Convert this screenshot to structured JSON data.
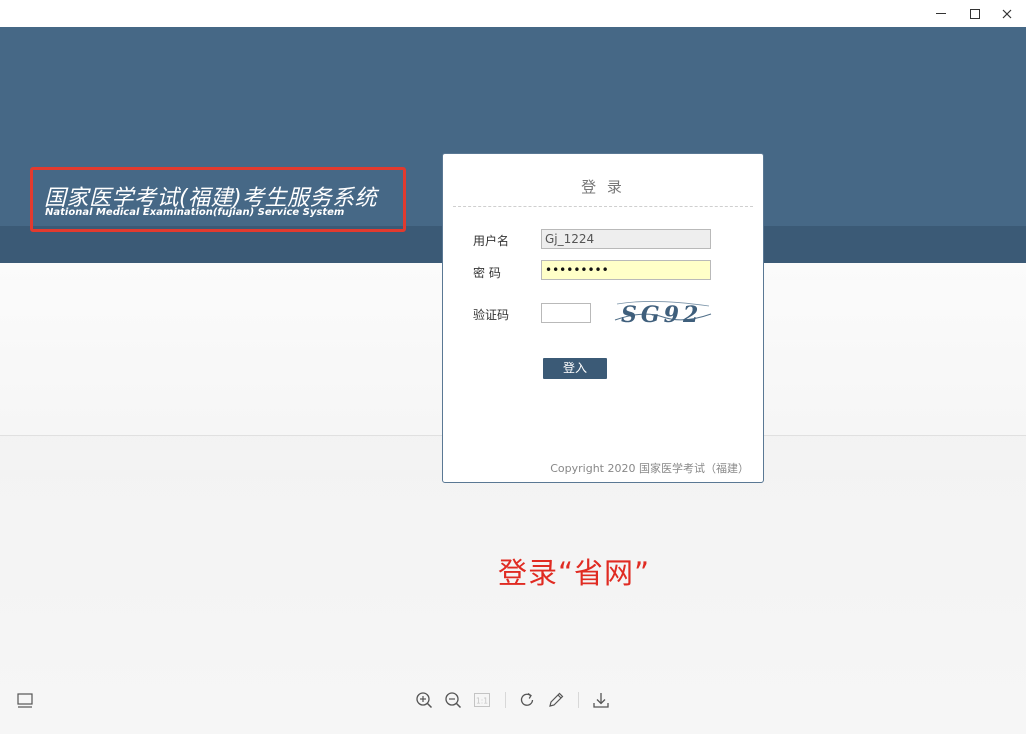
{
  "window": {
    "controls": [
      "minimize",
      "maximize",
      "close"
    ]
  },
  "banner": {
    "title_cn": "国家医学考试(福建)考生服务系统",
    "title_en": "National Medical Examination(fujian) Service System",
    "annotation_box_color": "#e23a2e"
  },
  "login": {
    "heading": "登 录",
    "username_label": "用户名",
    "username_value": "Gj_1224",
    "password_label": "密 码",
    "password_value": "•••••••••",
    "captcha_label": "验证码",
    "captcha_value": "",
    "captcha_text": "SG92",
    "submit_label": "登入",
    "copyright": "Copyright 2020 国家医学考试（福建）"
  },
  "annotation": {
    "text": "登录“省网”",
    "color": "#e02b22"
  },
  "toolbar": {
    "icons": [
      "layout-icon",
      "zoom-in-icon",
      "zoom-out-icon",
      "actual-size-icon",
      "rotate-icon",
      "edit-icon",
      "download-icon"
    ],
    "actual_size_label": "1:1"
  },
  "colors": {
    "banner": "#466886",
    "banner_band": "#3b5a76",
    "button": "#3b5a76",
    "password_field": "#ffffc8"
  }
}
